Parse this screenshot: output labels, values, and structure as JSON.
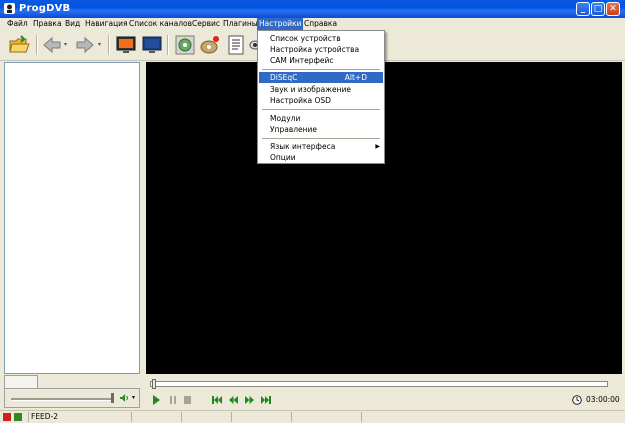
{
  "window": {
    "title": "ProgDVB"
  },
  "menubar": {
    "items": [
      "Файл",
      "Правка",
      "Вид",
      "Навигация",
      "Список каналов",
      "Сервис",
      "Плагины",
      "Настройки",
      "Справка"
    ]
  },
  "settings_menu": {
    "items": [
      {
        "label": "Список устройств"
      },
      {
        "label": "Настройка устройства"
      },
      {
        "label": "CAM Интерфейс"
      },
      {
        "label": "DiSEqC",
        "shortcut": "Alt+D"
      },
      {
        "label": "Звук и изображение"
      },
      {
        "label": "Настройка OSD"
      },
      {
        "label": "Модули"
      },
      {
        "label": "Управление"
      },
      {
        "label": "Язык интерфеса"
      },
      {
        "label": "Опции"
      }
    ]
  },
  "player": {
    "time": "03:00:00"
  },
  "status": {
    "channel": "FEED-2"
  },
  "colors": {
    "titlebar": "#0054e3",
    "highlight": "#316ac5",
    "video": "#000000",
    "chrome": "#ece9d8"
  },
  "icons": {
    "toolbar": [
      "open-folder-icon",
      "back-arrow-icon",
      "forward-arrow-icon",
      "tv-monitor-icon",
      "tv-off-icon",
      "record-settings-icon",
      "record-disc-icon",
      "epg-list-icon",
      "eye-icon"
    ],
    "player": [
      "play-icon",
      "pause-icon",
      "stop-icon",
      "skip-start-icon",
      "rewind-icon",
      "fast-forward-icon",
      "skip-end-icon",
      "clock-icon"
    ]
  }
}
